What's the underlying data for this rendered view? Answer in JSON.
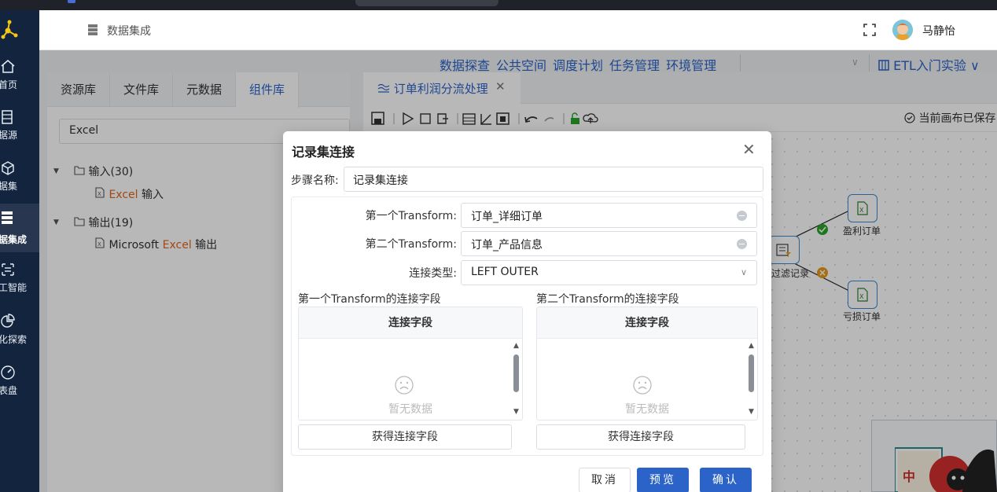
{
  "header": {
    "crumb": "数据集成",
    "user_name": "马静怡"
  },
  "nav": {
    "items": [
      {
        "label": "首页",
        "icon": "home-icon"
      },
      {
        "label": "数据源",
        "icon": "database-icon"
      },
      {
        "label": "数据集",
        "icon": "cube-icon"
      },
      {
        "label": "数据集成",
        "icon": "integration-icon",
        "active": true
      },
      {
        "label": "人工智能",
        "icon": "ai-icon"
      },
      {
        "label": "可视化探索",
        "icon": "chart-pie-icon"
      },
      {
        "label": "仪表盘",
        "icon": "dashboard-icon"
      }
    ]
  },
  "workspace_menu": {
    "items": [
      "数据探查",
      "公共空间",
      "调度计划",
      "任务管理",
      "环境管理"
    ],
    "project": "ETL入门实验"
  },
  "left_panel": {
    "tabs": [
      "资源库",
      "文件库",
      "元数据",
      "组件库"
    ],
    "active_tab": "组件库",
    "search_value": "Excel",
    "tree": {
      "input_group": "输入(30)",
      "input_item_hl": "Excel",
      "input_item_rest": " 输入",
      "output_group": "输出(19)",
      "output_item_pre": "Microsoft ",
      "output_item_hl": "Excel",
      "output_item_rest": " 输出"
    }
  },
  "canvas": {
    "tab_title": "订单利润分流处理",
    "saved_status": "当前画布已保存",
    "nodes": {
      "filter": "过滤记录",
      "profit": "盈利订单",
      "loss": "亏损订单"
    }
  },
  "modal": {
    "title": "记录集连接",
    "step_name_label": "步骤名称:",
    "step_name_value": "记录集连接",
    "first_transform_label": "第一个Transform:",
    "first_transform_value": "订单_详细订单",
    "second_transform_label": "第二个Transform:",
    "second_transform_value": "订单_产品信息",
    "join_type_label": "连接类型:",
    "join_type_value": "LEFT OUTER",
    "left_fields_label": "第一个Transform的连接字段",
    "right_fields_label": "第二个Transform的连接字段",
    "table_header": "连接字段",
    "empty_text": "暂无数据",
    "get_fields_button": "获得连接字段",
    "cancel_button": "取消",
    "preview_button": "预览",
    "confirm_button": "确认"
  },
  "colors": {
    "primary": "#2b63c9",
    "nav_bg": "#13253e",
    "highlight": "#e0661a",
    "success": "#2aa52a",
    "warning": "#e89a1c"
  }
}
